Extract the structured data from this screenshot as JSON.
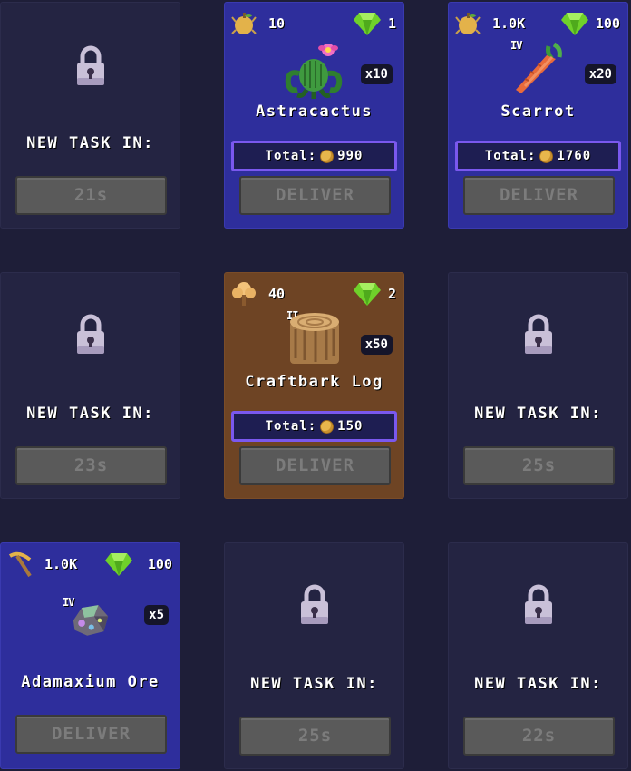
{
  "labels": {
    "new_task": "NEW TASK IN:",
    "deliver": "DELIVER",
    "total": "Total:"
  },
  "cards": [
    {
      "state": "locked",
      "timer": "21s"
    },
    {
      "state": "active",
      "theme": "blue",
      "resource_icon": "apple-icon",
      "resource_value": "10",
      "gem_value": "1",
      "tier": "",
      "item": "Astracactus",
      "item_icon": "cactus-icon",
      "qty": "x10",
      "total": "990"
    },
    {
      "state": "active",
      "theme": "blue",
      "resource_icon": "apple-icon",
      "resource_value": "1.0K",
      "gem_value": "100",
      "tier": "IV",
      "item": "Scarrot",
      "item_icon": "carrot-icon",
      "qty": "x20",
      "total": "1760"
    },
    {
      "state": "locked",
      "timer": "23s"
    },
    {
      "state": "active",
      "theme": "wood",
      "resource_icon": "tree-icon",
      "resource_value": "40",
      "gem_value": "2",
      "tier": "II",
      "item": "Craftbark Log",
      "item_icon": "log-icon",
      "qty": "x50",
      "total": "150"
    },
    {
      "state": "locked",
      "timer": "25s"
    },
    {
      "state": "active",
      "theme": "blue",
      "resource_icon": "pickaxe-icon",
      "resource_value": "1.0K",
      "gem_value": "100",
      "tier": "IV",
      "item": "Adamaxium Ore",
      "item_icon": "ore-icon",
      "qty": "x5",
      "total": ""
    },
    {
      "state": "locked",
      "timer": "25s"
    },
    {
      "state": "locked",
      "timer": "22s"
    }
  ],
  "colors": {
    "background": "#1e1e38",
    "locked_card": "#242442",
    "blue_card": "#2e2e9c",
    "wood_card": "#6e4424",
    "total_border": "#7a58ee",
    "gem": "#6fd12a"
  }
}
